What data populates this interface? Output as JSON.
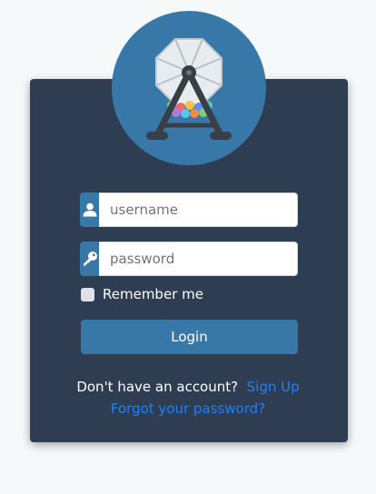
{
  "login": {
    "username_placeholder": "username",
    "password_placeholder": "password",
    "remember_label": "Remember me",
    "remember_checked": false,
    "login_button": "Login",
    "signup_prompt": "Don't have an account?",
    "signup_link": "Sign Up",
    "forgot_link": "Forgot your password?"
  },
  "icons": {
    "logo": "lottery-drum-icon",
    "username": "user-icon",
    "password": "key-icon"
  },
  "colors": {
    "card": "#2e3d52",
    "accent": "#3878a9",
    "link": "#1a82ff"
  }
}
